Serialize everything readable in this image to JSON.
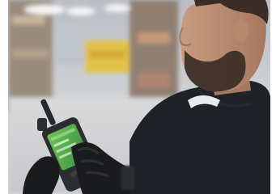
{
  "image": {
    "subject": "worker-using-rugged-handheld-device",
    "colors": {
      "warehouse_background": "#c7cbd0",
      "floor": "#d8d9da",
      "shirt": "#1f2328",
      "gloves": "#1a1b1d",
      "device_body": "#2b2e31",
      "screen": "#4fa64a",
      "skin": "#b98c72",
      "beard": "#3b2d25"
    }
  }
}
